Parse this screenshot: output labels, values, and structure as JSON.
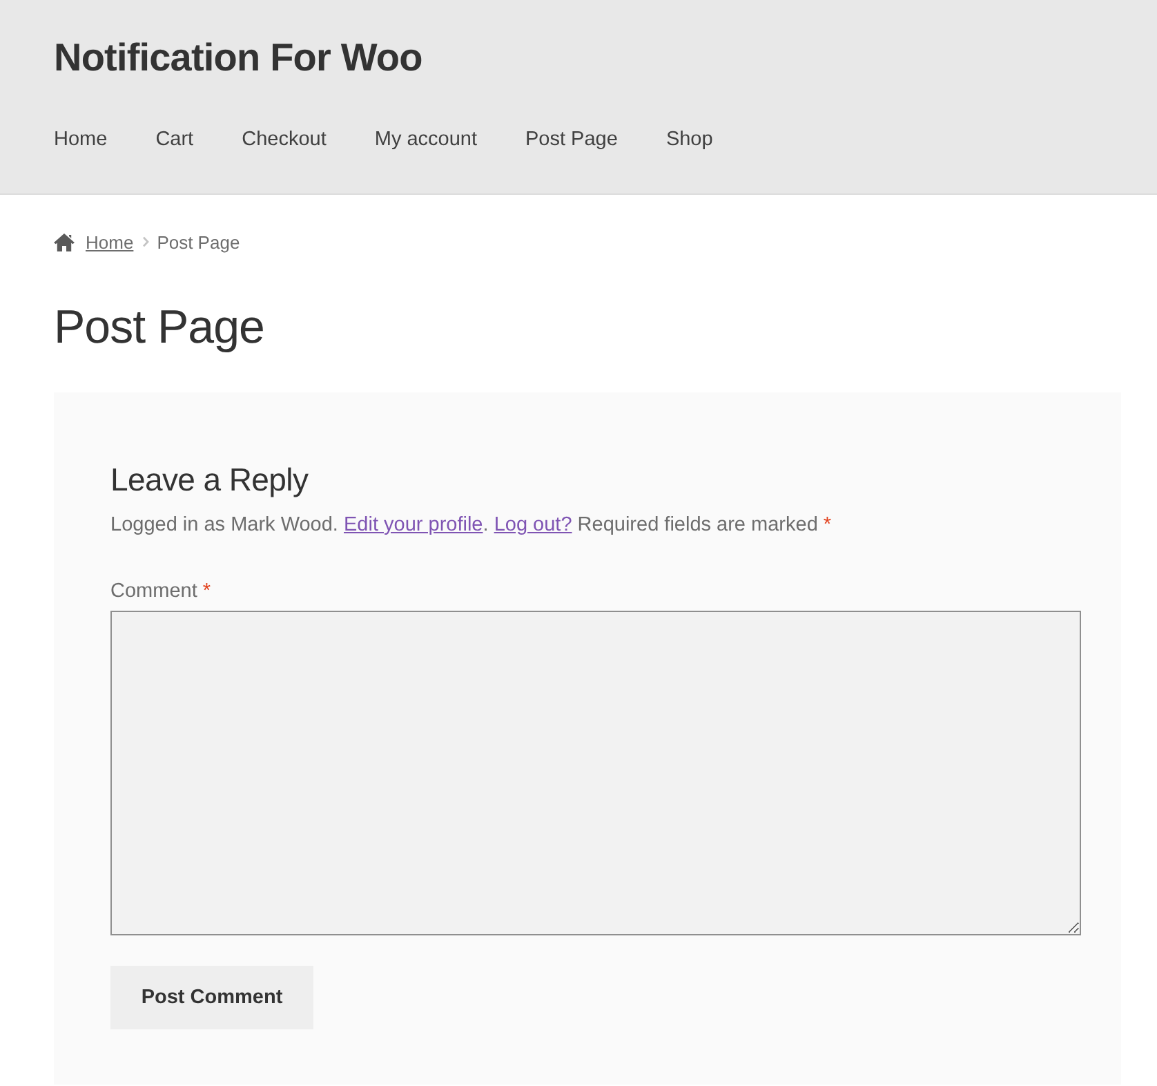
{
  "site": {
    "title": "Notification For Woo"
  },
  "nav": [
    {
      "label": "Home"
    },
    {
      "label": "Cart"
    },
    {
      "label": "Checkout"
    },
    {
      "label": "My account"
    },
    {
      "label": "Post Page"
    },
    {
      "label": "Shop"
    }
  ],
  "breadcrumb": [
    {
      "kind": "link",
      "label": "Home"
    },
    {
      "kind": "current",
      "label": "Post Page"
    }
  ],
  "page_title": "Post Page",
  "reply": {
    "title": "Leave a Reply",
    "notice": {
      "lead": "Logged in as Mark Wood.",
      "profile_link": "Edit your profile",
      "profile_link_end": ".",
      "logout_link": "Log out?",
      "required_note": "Required fields are marked",
      "required_mark": "*"
    },
    "comment": {
      "label": "Comment",
      "required_mark": "*"
    },
    "submit": {
      "label": "Post Comment"
    }
  }
}
